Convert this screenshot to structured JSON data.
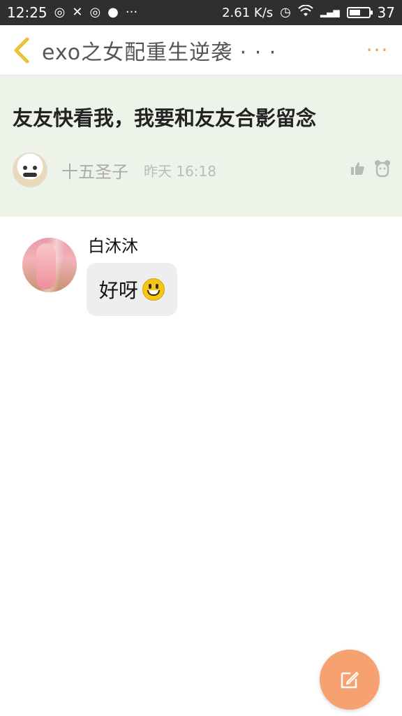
{
  "status_bar": {
    "time": "12:25",
    "net_speed": "2.61 K/s",
    "battery_percent": "37",
    "battery_level": 0.5
  },
  "header": {
    "title": "exo之女配重生逆袭 · · ·",
    "more_label": "···"
  },
  "post": {
    "title": "友友快看我，我要和友友合影留念",
    "author": "十五圣子",
    "time": "昨天 16:18"
  },
  "comments": [
    {
      "name": "白沐沐",
      "text": "好呀",
      "emoji": "grinning-face-emoji"
    }
  ],
  "colors": {
    "accent": "#f39a4a",
    "fab": "#f7a070",
    "post_bg": "#eef3ea",
    "status_bar_bg": "#2f2f2f"
  }
}
